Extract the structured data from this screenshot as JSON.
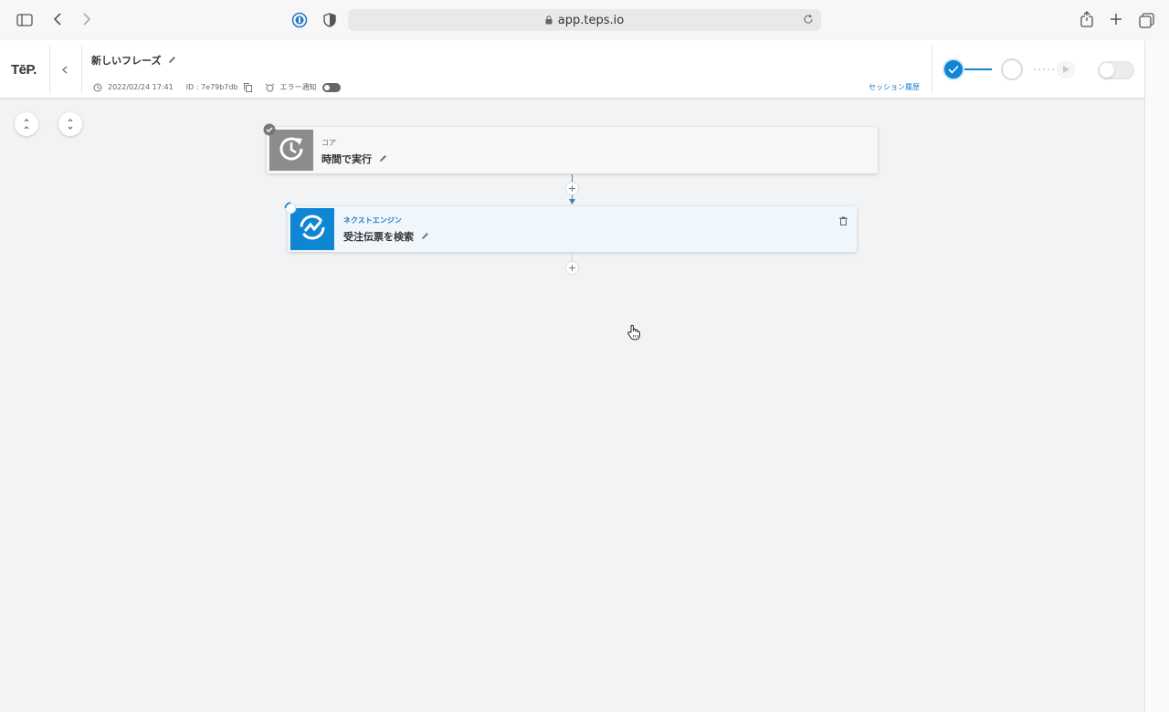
{
  "browser": {
    "url": "app.teps.io"
  },
  "header": {
    "logo": "TēP.",
    "flow_title": "新しいフレーズ",
    "timestamp": "2022/02/24 17:41",
    "id_text": "ID : 7e79b7db",
    "error_notify_label": "エラー通知",
    "session_history": "セッション履歴"
  },
  "nodes": [
    {
      "category": "コア",
      "name": "時間で実行"
    },
    {
      "category": "ネクストエンジン",
      "name": "受注伝票を検索"
    }
  ],
  "plus_symbol": "+",
  "colors": {
    "accent": "#0e86d4",
    "link": "#1f7ac5",
    "core_icon_bg": "#8c8c8c"
  }
}
